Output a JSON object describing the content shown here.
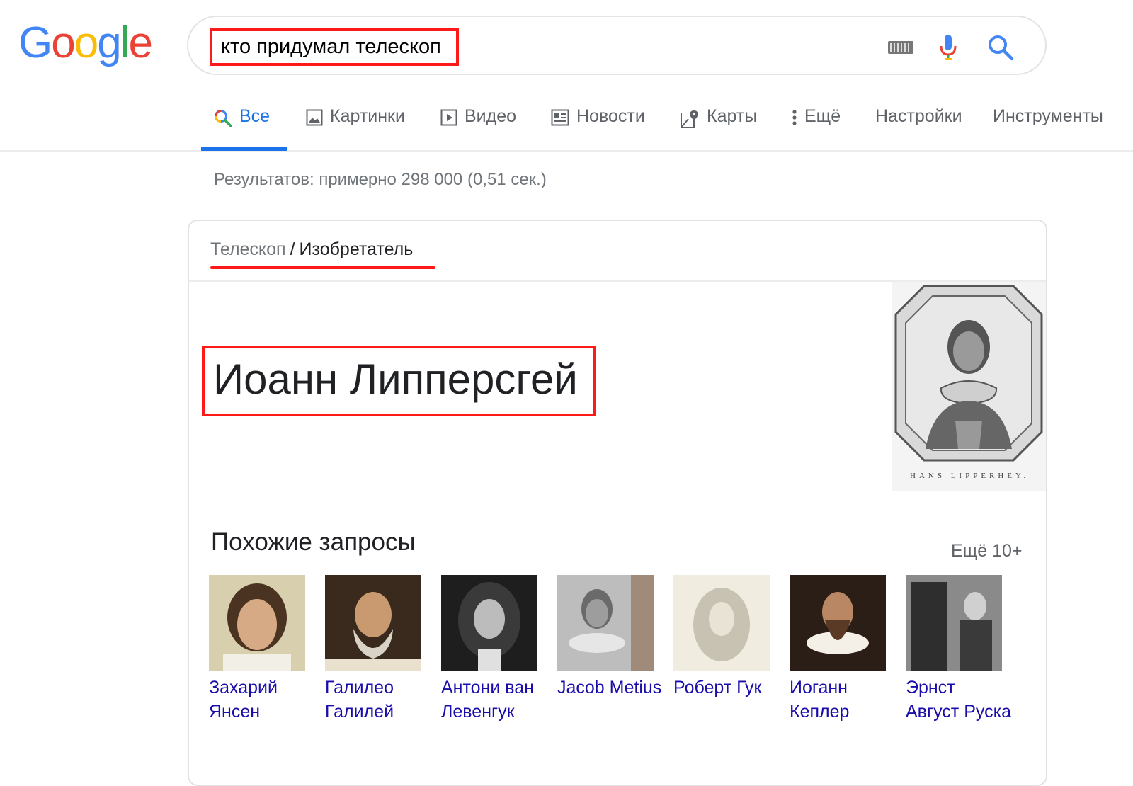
{
  "logo": {
    "letters": [
      "G",
      "o",
      "o",
      "g",
      "l",
      "e"
    ],
    "colors": [
      "#4285F4",
      "#EA4335",
      "#FBBC05",
      "#4285F4",
      "#34A853",
      "#EA4335"
    ]
  },
  "search": {
    "query": "кто придумал телескоп"
  },
  "icons": {
    "keyboard": "keyboard-icon",
    "mic": "mic-icon",
    "search": "search-icon"
  },
  "tabs": [
    {
      "label": "Все",
      "icon": "search-icon",
      "active": true
    },
    {
      "label": "Картинки",
      "icon": "image-icon"
    },
    {
      "label": "Видео",
      "icon": "play-icon"
    },
    {
      "label": "Новости",
      "icon": "news-icon"
    },
    {
      "label": "Карты",
      "icon": "map-pin-icon"
    },
    {
      "label": "Ещё",
      "icon": "more-vert-icon"
    },
    {
      "label": "Настройки"
    },
    {
      "label": "Инструменты"
    }
  ],
  "results_stats": "Результатов: примерно 298 000 (0,51 сек.)",
  "knowledge_card": {
    "breadcrumb": {
      "parent": "Телескоп",
      "separator": "/",
      "current": "Изобретатель"
    },
    "answer": "Иоанн Липперсгей",
    "portrait_caption": "HANS LIPPERHEY.",
    "related_title": "Похожие запросы",
    "more_label": "Ещё 10+",
    "related": [
      {
        "name": "Захарий Янсен"
      },
      {
        "name": "Галилео Галилей"
      },
      {
        "name": "Антони ван Левенгук"
      },
      {
        "name": "Jacob Metius"
      },
      {
        "name": "Роберт Гук"
      },
      {
        "name": "Иоганн Кеплер"
      },
      {
        "name": "Эрнст Август Руска"
      }
    ]
  },
  "colors": {
    "link": "#1a0dab",
    "active_tab": "#1a73e8",
    "highlight": "#ff1a1a",
    "muted": "#70757a"
  }
}
